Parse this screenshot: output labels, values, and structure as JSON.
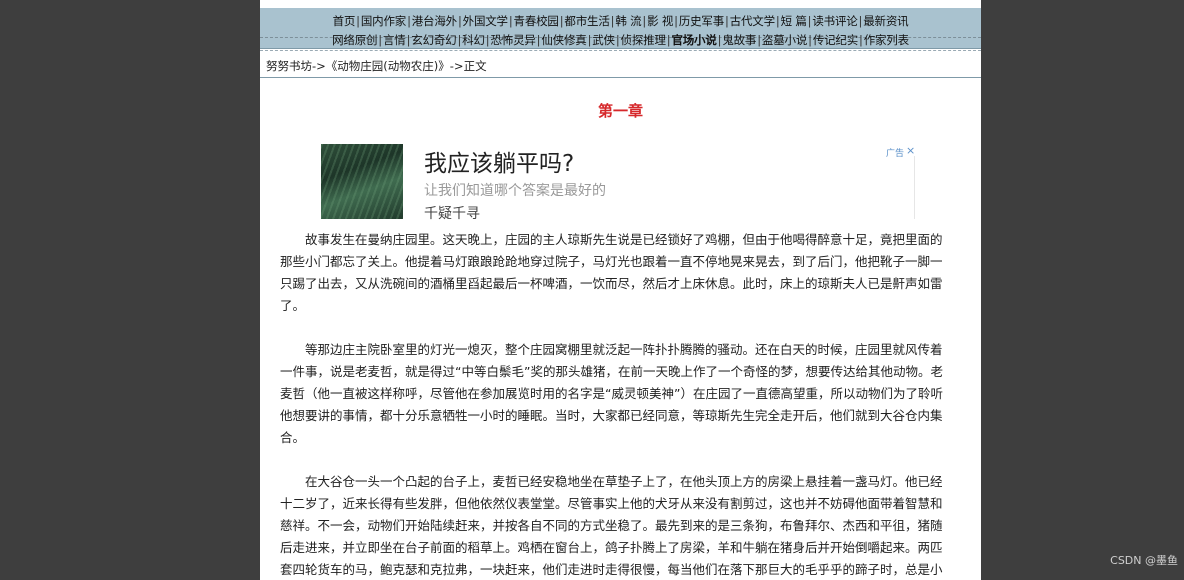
{
  "nav": {
    "row1": [
      "首页",
      "国内作家",
      "港台海外",
      "外国文学",
      "青春校园",
      "都市生活",
      "韩 流",
      "影 视",
      "历史军事",
      "古代文学",
      "短 篇",
      "读书评论",
      "最新资讯"
    ],
    "row2": [
      "网络原创",
      "言情",
      "玄幻奇幻",
      "科幻",
      "恐怖灵异",
      "仙侠修真",
      "武侠",
      "侦探推理",
      "官场小说",
      "鬼故事",
      "盗墓小说",
      "传记纪实",
      "作家列表"
    ]
  },
  "breadcrumb": {
    "site": "努努书坊",
    "book": "《动物庄园(动物农庄)》",
    "current": "正文",
    "arrow": "->"
  },
  "chapter": {
    "title": "第一章"
  },
  "ad": {
    "title": "我应该躺平吗?",
    "subtitle": "让我们知道哪个答案是最好的",
    "brand": "千疑千寻",
    "tag": "广告",
    "close": "×"
  },
  "paragraphs": [
    "故事发生在曼纳庄园里。这天晚上，庄园的主人琼斯先生说是已经锁好了鸡棚，但由于他喝得醉意十足，竟把里面的那些小门都忘了关上。他提着马灯踉踉跄跄地穿过院子，马灯光也跟着一直不停地晃来晃去，到了后门，他把靴子一脚一只踢了出去，又从洗碗间的酒桶里舀起最后一杯啤酒，一饮而尽，然后才上床休息。此时，床上的琼斯夫人已是鼾声如雷了。",
    "等那边庄主院卧室里的灯光一熄灭，整个庄园窝棚里就泛起一阵扑扑腾腾的骚动。还在白天的时候，庄园里就风传着一件事，说是老麦哲，就是得过“中等白鬃毛”奖的那头雄猪，在前一天晚上作了一个奇怪的梦，想要传达给其他动物。老麦哲（他一直被这样称呼，尽管他在参加展览时用的名字是“威灵顿美神”）在庄园了一直德高望重，所以动物们为了聆听他想要讲的事情，都十分乐意牺牲一小时的睡眠。当时，大家都已经同意，等琼斯先生完全走开后，他们就到大谷仓内集合。",
    "在大谷仓一头一个凸起的台子上，麦哲已经安稳地坐在草垫子上了，在他头顶上方的房梁上悬挂着一盏马灯。他已经十二岁了，近来长得有些发胖，但他依然仪表堂堂。尽管事实上他的犬牙从来没有割剪过，这也并不妨碍他面带着智慧和慈祥。不一会，动物们开始陆续赶来，并按各自不同的方式坐稳了。最先到来的是三条狗，布鲁拜尔、杰西和平徂，猪随后走进来，并立即坐在台子前面的稻草上。鸡栖在窗台上，鸽子扑腾上了房梁，羊和牛躺在猪身后并开始倒嚼起来。两匹套四轮货车的马，鲍克瑟和克拉弗，一块赶来，他们走进时走得很慢，每当他们在落下那巨大的毛乎乎的蹄子时，总是小"
  ],
  "watermark": "CSDN @墨鱼"
}
